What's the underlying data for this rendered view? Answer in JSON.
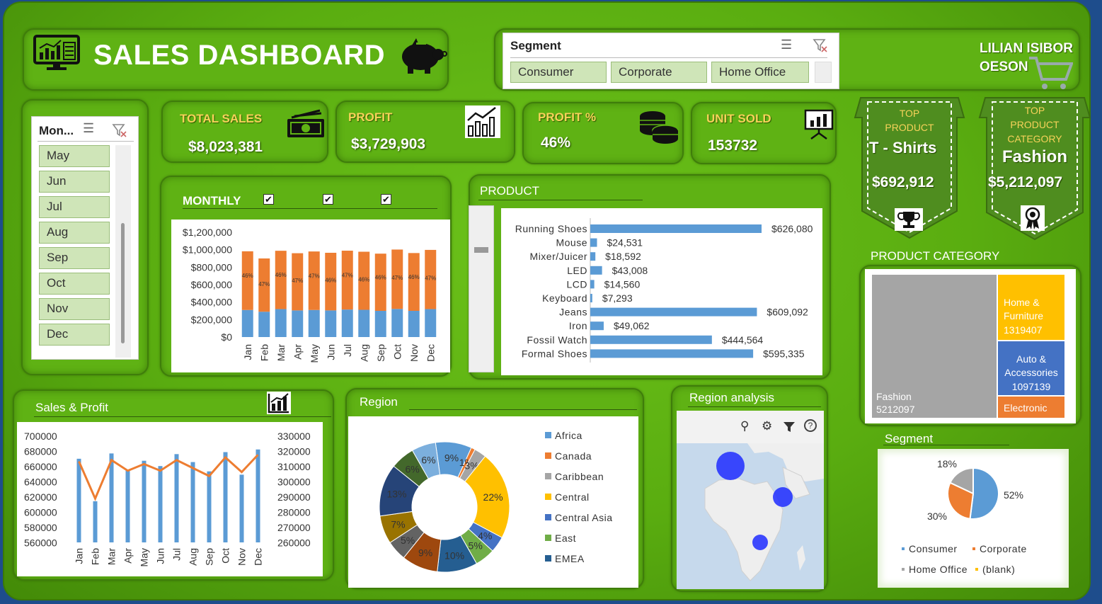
{
  "header": {
    "title": "SALES DASHBOARD",
    "author": "LILIAN ISIBOR\nOESON"
  },
  "segment_slicer": {
    "title": "Segment",
    "items": [
      "Consumer",
      "Corporate",
      "Home Office"
    ]
  },
  "month_slicer": {
    "title": "Mon...",
    "items": [
      "May",
      "Jun",
      "Jul",
      "Aug",
      "Sep",
      "Oct",
      "Nov",
      "Dec"
    ]
  },
  "kpis": {
    "total_sales": {
      "label": "TOTAL SALES",
      "value": "$8,023,381"
    },
    "profit": {
      "label": "PROFIT",
      "value": "$3,729,903"
    },
    "profit_pct": {
      "label": "PROFIT %",
      "value": "46%"
    },
    "unit_sold": {
      "label": "UNIT SOLD",
      "value": "153732"
    }
  },
  "top_product": {
    "label1": "TOP",
    "label2": "PRODUCT",
    "name": "T - Shirts",
    "value": "$692,912"
  },
  "top_category": {
    "label1": "TOP",
    "label2": "PRODUCT",
    "label3": "CATEGORY",
    "name": "Fashion",
    "value": "$5,212,097"
  },
  "monthly": {
    "title": "MONTHLY"
  },
  "product": {
    "title": "PRODUCT"
  },
  "product_category": {
    "title": "PRODUCT CATEGORY"
  },
  "sales_profit": {
    "title": "Sales & Profit"
  },
  "region": {
    "title": "Region"
  },
  "region_analysis": {
    "title": "Region analysis"
  },
  "segment_chart": {
    "title": "Segment"
  },
  "colors": {
    "blue": "#5b9bd5",
    "orange": "#ed7d31",
    "gray": "#a5a5a5",
    "yellow": "#ffc000",
    "green_bg": "#5fb214"
  },
  "chart_data": [
    {
      "id": "monthly",
      "type": "bar",
      "categories": [
        "Jan",
        "Feb",
        "Mar",
        "Apr",
        "May",
        "Jun",
        "Jul",
        "Aug",
        "Sep",
        "Oct",
        "Nov",
        "Dec"
      ],
      "series": [
        {
          "values": [
            310000,
            290000,
            320000,
            305000,
            310000,
            305000,
            315000,
            312000,
            300000,
            322000,
            300000,
            320000
          ]
        },
        {
          "values": [
            672000,
            610000,
            668000,
            655000,
            670000,
            660000,
            674000,
            665000,
            655000,
            680000,
            662000,
            678000
          ]
        }
      ],
      "labels": [
        "46%",
        "47%",
        "46%",
        "47%",
        "47%",
        "46%",
        "47%",
        "46%",
        "46%",
        "47%",
        "46%",
        "47%"
      ],
      "yticks": [
        "$1,200,000",
        "$1,000,000",
        "$800,000",
        "$600,000",
        "$400,000",
        "$200,000",
        "$0"
      ],
      "ylim": [
        0,
        1200000
      ]
    },
    {
      "id": "product",
      "type": "bar",
      "categories": [
        "Running Shoes",
        "Mouse",
        "Mixer/Juicer",
        "LED",
        "LCD",
        "Keyboard",
        "Jeans",
        "Iron",
        "Fossil Watch",
        "Formal Shoes"
      ],
      "values": [
        626080,
        24531,
        18592,
        43008,
        14560,
        7293,
        609092,
        49062,
        444564,
        595335
      ],
      "labels": [
        "$626,080",
        "$24,531",
        "$18,592",
        "$43,008",
        "$14,560",
        "$7,293",
        "$609,092",
        "$49,062",
        "$444,564",
        "$595,335"
      ]
    },
    {
      "id": "product_category",
      "type": "treemap",
      "items": [
        {
          "name": "Fashion",
          "value": 5212097,
          "label": "5212097"
        },
        {
          "name": "Home &\nFurniture",
          "value": 1319407,
          "label": "1319407"
        },
        {
          "name": "Auto &\nAccessories",
          "value": 1097139,
          "label": "1097139"
        },
        {
          "name": "Electronic",
          "value": 394738,
          "label": ""
        }
      ]
    },
    {
      "id": "sales_profit",
      "type": "bar",
      "categories": [
        "Jan",
        "Feb",
        "Mar",
        "Apr",
        "May",
        "Jun",
        "Jul",
        "Aug",
        "Sep",
        "Oct",
        "Nov",
        "Dec"
      ],
      "series": [
        {
          "values": [
            676000,
            612000,
            684000,
            659000,
            673000,
            665000,
            683000,
            671000,
            657000,
            686000,
            652000,
            690000
          ]
        },
        {
          "values": [
            316000,
            288000,
            317000,
            309000,
            314000,
            309000,
            317000,
            311000,
            305000,
            319000,
            308000,
            321000
          ]
        }
      ],
      "yticks_left": [
        "700000",
        "680000",
        "660000",
        "640000",
        "620000",
        "600000",
        "580000",
        "560000"
      ],
      "yticks_right": [
        "330000",
        "320000",
        "310000",
        "300000",
        "290000",
        "280000",
        "270000",
        "260000"
      ],
      "ylim_left": [
        550000,
        710000
      ],
      "ylim_right": [
        255000,
        335000
      ]
    },
    {
      "id": "region",
      "type": "pie",
      "legend": [
        "Africa",
        "Canada",
        "Caribbean",
        "Central",
        "Central Asia",
        "East",
        "EMEA"
      ],
      "slices": [
        {
          "value": 9,
          "color": "#5b9bd5",
          "label": "9%"
        },
        {
          "value": 1,
          "color": "#ed7d31",
          "label": "1%"
        },
        {
          "value": 3,
          "color": "#a5a5a5",
          "label": "3%"
        },
        {
          "value": 22,
          "color": "#ffc000",
          "label": "22%"
        },
        {
          "value": 4,
          "color": "#4472c4",
          "label": "4%"
        },
        {
          "value": 5,
          "color": "#70ad47",
          "label": "5%"
        },
        {
          "value": 10,
          "color": "#255e91",
          "label": "10%"
        },
        {
          "value": 9,
          "color": "#9e480e",
          "label": "9%"
        },
        {
          "value": 5,
          "color": "#636363",
          "label": "5%"
        },
        {
          "value": 7,
          "color": "#997300",
          "label": "7%"
        },
        {
          "value": 13,
          "color": "#264478",
          "label": "13%"
        },
        {
          "value": 6,
          "color": "#43682b",
          "label": "6%"
        },
        {
          "value": 6,
          "color": "#7cafdd",
          "label": "6%"
        }
      ]
    },
    {
      "id": "segment",
      "type": "pie",
      "legend": [
        "Consumer",
        "Corporate",
        "Home Office",
        "(blank)"
      ],
      "slices": [
        {
          "value": 52,
          "color": "#5b9bd5",
          "label": "52%"
        },
        {
          "value": 30,
          "color": "#ed7d31",
          "label": "30%"
        },
        {
          "value": 18,
          "color": "#a5a5a5",
          "label": "18%"
        }
      ]
    }
  ]
}
